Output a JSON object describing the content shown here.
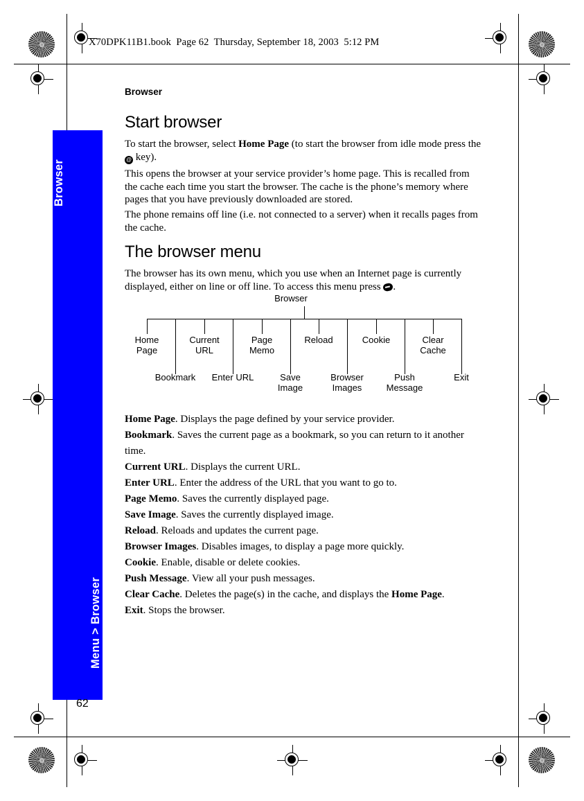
{
  "header": {
    "book_line": "X70DPK11B1.book  Page 62  Thursday, September 18, 2003  5:12 PM"
  },
  "sidebar": {
    "tab_top_label": "Browser",
    "tab_bottom_label": "Menu > Browser",
    "color": "#0000FF",
    "text_color": "#FFFFFF"
  },
  "running_head": "Browser",
  "page_number": "62",
  "sections": [
    {
      "heading": "Start browser",
      "paragraphs": [
        "To start the browser, select Home Page (to start the browser from idle mode press the  key).",
        "This opens the browser at your service provider’s home page. This is recalled from the cache each time you start the browser. The cache is the phone’s memory where pages that you have previously downloaded are stored.",
        "The phone remains off line (i.e. not connected to a server) when it recalls pages from the cache."
      ]
    },
    {
      "heading": "The browser menu",
      "paragraphs": [
        "The browser has its own menu, which you use when an Internet page is currently displayed, either on line or off line. To access this menu press  ."
      ]
    }
  ],
  "paragraph_parts": {
    "p1_a": "To start the browser, select ",
    "p1_bold": "Home Page",
    "p1_b": " (to start the browser from idle mode press the ",
    "p1_c": " key).",
    "p2": "This opens the browser at your service provider’s home page. This is recalled from the cache each time you start the browser. The cache is the phone’s memory where pages that you have previously downloaded are stored.",
    "p3": "The phone remains off line (i.e. not connected to a server) when it recalls pages from the cache.",
    "p4_a": "The browser has its own menu, which you use when an Internet page is currently displayed, either on line or off line. To access this menu press ",
    "p4_b": "."
  },
  "icons": {
    "at_key": "at-key-icon",
    "menu_key": "menu-key-icon"
  },
  "tree": {
    "root": "Browser",
    "upper_nodes": [
      "Home\nPage",
      "Current\nURL",
      "Page\nMemo",
      "Reload",
      "Cookie",
      "Clear\nCache"
    ],
    "lower_nodes": [
      "Bookmark",
      "Enter URL",
      "Save\nImage",
      "Browser\nImages",
      "Push\nMessage",
      "Exit"
    ]
  },
  "definitions": [
    {
      "term": "Home Page",
      "desc": ". Displays the page defined by your service provider."
    },
    {
      "term": "Bookmark",
      "desc": ". Saves the current page as a bookmark, so you can return to it another time."
    },
    {
      "term": "Current URL",
      "desc": ". Displays the current URL."
    },
    {
      "term": "Enter URL",
      "desc": ". Enter the address of the URL that you want to go to."
    },
    {
      "term": "Page Memo",
      "desc": ". Saves the currently displayed page."
    },
    {
      "term": "Save Image",
      "desc": ". Saves the currently displayed image."
    },
    {
      "term": "Reload",
      "desc": ". Reloads and updates the current page."
    },
    {
      "term": "Browser Images",
      "desc": ". Disables images, to display a page more quickly."
    },
    {
      "term": "Cookie",
      "desc": ". Enable, disable or delete cookies."
    },
    {
      "term": "Push Message",
      "desc": ". View all your push messages."
    },
    {
      "term": "Clear Cache",
      "desc": ". Deletes the page(s) in the cache, and displays the ",
      "desc_bold": "Home Page",
      "desc_tail": "."
    },
    {
      "term": "Exit",
      "desc": ". Stops the browser."
    }
  ]
}
